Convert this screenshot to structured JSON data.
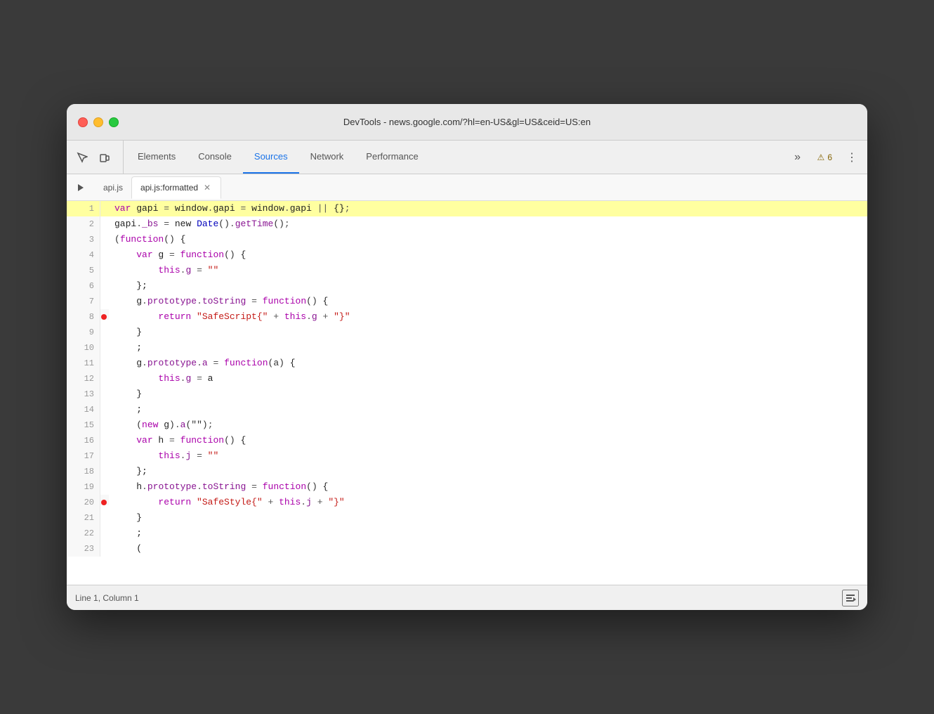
{
  "titleBar": {
    "title": "DevTools - news.google.com/?hl=en-US&gl=US&ceid=US:en"
  },
  "toolbar": {
    "tabs": [
      {
        "id": "elements",
        "label": "Elements",
        "active": false
      },
      {
        "id": "console",
        "label": "Console",
        "active": false
      },
      {
        "id": "sources",
        "label": "Sources",
        "active": true
      },
      {
        "id": "network",
        "label": "Network",
        "active": false
      },
      {
        "id": "performance",
        "label": "Performance",
        "active": false
      }
    ],
    "moreLabel": "»",
    "warningCount": "6",
    "warningIcon": "⚠"
  },
  "fileTabs": [
    {
      "id": "api-js",
      "label": "api.js",
      "active": false,
      "closeable": false
    },
    {
      "id": "api-js-formatted",
      "label": "api.js:formatted",
      "active": true,
      "closeable": true
    }
  ],
  "codeLines": [
    {
      "num": 1,
      "highlighted": true,
      "breakpoint": false,
      "tokens": [
        {
          "type": "kw",
          "text": "var"
        },
        {
          "type": "id",
          "text": " gapi "
        },
        {
          "type": "op",
          "text": "="
        },
        {
          "type": "id",
          "text": " window"
        },
        {
          "type": "op",
          "text": "."
        },
        {
          "type": "id",
          "text": "gapi "
        },
        {
          "type": "op",
          "text": "="
        },
        {
          "type": "id",
          "text": " window"
        },
        {
          "type": "op",
          "text": "."
        },
        {
          "type": "id",
          "text": "gapi "
        },
        {
          "type": "op",
          "text": "||"
        },
        {
          "type": "id",
          "text": " {}"
        },
        {
          "type": "op",
          "text": ";"
        }
      ]
    },
    {
      "num": 2,
      "highlighted": false,
      "breakpoint": false,
      "tokens": [
        {
          "type": "id",
          "text": "gapi"
        },
        {
          "type": "op",
          "text": "."
        },
        {
          "type": "prop",
          "text": "_bs"
        },
        {
          "type": "op",
          "text": " ="
        },
        {
          "type": "id",
          "text": " new "
        },
        {
          "type": "blue-id",
          "text": "Date"
        },
        {
          "type": "paren",
          "text": "()"
        },
        {
          "type": "op",
          "text": "."
        },
        {
          "type": "prop",
          "text": "getTime"
        },
        {
          "type": "paren",
          "text": "()"
        },
        {
          "type": "op",
          "text": ";"
        }
      ]
    },
    {
      "num": 3,
      "highlighted": false,
      "breakpoint": false,
      "tokens": [
        {
          "type": "paren",
          "text": "("
        },
        {
          "type": "fn-kw",
          "text": "function"
        },
        {
          "type": "paren",
          "text": "()"
        },
        {
          "type": "id",
          "text": " {"
        }
      ]
    },
    {
      "num": 4,
      "highlighted": false,
      "breakpoint": false,
      "tokens": [
        {
          "type": "id",
          "text": "    "
        },
        {
          "type": "kw",
          "text": "var"
        },
        {
          "type": "id",
          "text": " g "
        },
        {
          "type": "op",
          "text": "="
        },
        {
          "type": "id",
          "text": " "
        },
        {
          "type": "fn-kw",
          "text": "function"
        },
        {
          "type": "paren",
          "text": "()"
        },
        {
          "type": "id",
          "text": " {"
        }
      ]
    },
    {
      "num": 5,
      "highlighted": false,
      "breakpoint": false,
      "tokens": [
        {
          "type": "id",
          "text": "        "
        },
        {
          "type": "kw",
          "text": "this"
        },
        {
          "type": "op",
          "text": "."
        },
        {
          "type": "prop",
          "text": "g"
        },
        {
          "type": "op",
          "text": " ="
        },
        {
          "type": "str",
          "text": " \"\""
        }
      ]
    },
    {
      "num": 6,
      "highlighted": false,
      "breakpoint": false,
      "tokens": [
        {
          "type": "id",
          "text": "    "
        },
        {
          "type": "id",
          "text": "};"
        }
      ]
    },
    {
      "num": 7,
      "highlighted": false,
      "breakpoint": false,
      "tokens": [
        {
          "type": "id",
          "text": "    "
        },
        {
          "type": "id",
          "text": "g"
        },
        {
          "type": "op",
          "text": "."
        },
        {
          "type": "prop",
          "text": "prototype"
        },
        {
          "type": "op",
          "text": "."
        },
        {
          "type": "prop",
          "text": "toString"
        },
        {
          "type": "op",
          "text": " ="
        },
        {
          "type": "id",
          "text": " "
        },
        {
          "type": "fn-kw",
          "text": "function"
        },
        {
          "type": "paren",
          "text": "()"
        },
        {
          "type": "id",
          "text": " {"
        }
      ]
    },
    {
      "num": 8,
      "highlighted": false,
      "breakpoint": true,
      "tokens": [
        {
          "type": "id",
          "text": "        "
        },
        {
          "type": "kw",
          "text": "return"
        },
        {
          "type": "str",
          "text": " \"SafeScript{\""
        },
        {
          "type": "op",
          "text": " +"
        },
        {
          "type": "id",
          "text": " "
        },
        {
          "type": "kw",
          "text": "this"
        },
        {
          "type": "op",
          "text": "."
        },
        {
          "type": "prop",
          "text": "g"
        },
        {
          "type": "op",
          "text": " +"
        },
        {
          "type": "str",
          "text": " \"}\""
        }
      ]
    },
    {
      "num": 9,
      "highlighted": false,
      "breakpoint": false,
      "tokens": [
        {
          "type": "id",
          "text": "    }"
        }
      ]
    },
    {
      "num": 10,
      "highlighted": false,
      "breakpoint": false,
      "tokens": [
        {
          "type": "id",
          "text": "    ;"
        }
      ]
    },
    {
      "num": 11,
      "highlighted": false,
      "breakpoint": false,
      "tokens": [
        {
          "type": "id",
          "text": "    "
        },
        {
          "type": "id",
          "text": "g"
        },
        {
          "type": "op",
          "text": "."
        },
        {
          "type": "prop",
          "text": "prototype"
        },
        {
          "type": "op",
          "text": "."
        },
        {
          "type": "prop",
          "text": "a"
        },
        {
          "type": "op",
          "text": " ="
        },
        {
          "type": "id",
          "text": " "
        },
        {
          "type": "fn-kw",
          "text": "function"
        },
        {
          "type": "paren",
          "text": "(a)"
        },
        {
          "type": "id",
          "text": " {"
        }
      ]
    },
    {
      "num": 12,
      "highlighted": false,
      "breakpoint": false,
      "tokens": [
        {
          "type": "id",
          "text": "        "
        },
        {
          "type": "kw",
          "text": "this"
        },
        {
          "type": "op",
          "text": "."
        },
        {
          "type": "prop",
          "text": "g"
        },
        {
          "type": "op",
          "text": " ="
        },
        {
          "type": "id",
          "text": " a"
        }
      ]
    },
    {
      "num": 13,
      "highlighted": false,
      "breakpoint": false,
      "tokens": [
        {
          "type": "id",
          "text": "    }"
        }
      ]
    },
    {
      "num": 14,
      "highlighted": false,
      "breakpoint": false,
      "tokens": [
        {
          "type": "id",
          "text": "    ;"
        }
      ]
    },
    {
      "num": 15,
      "highlighted": false,
      "breakpoint": false,
      "tokens": [
        {
          "type": "id",
          "text": "    "
        },
        {
          "type": "paren",
          "text": "("
        },
        {
          "type": "kw",
          "text": "new"
        },
        {
          "type": "id",
          "text": " g"
        },
        {
          "type": "paren",
          "text": ")"
        },
        {
          "type": "op",
          "text": "."
        },
        {
          "type": "prop",
          "text": "a"
        },
        {
          "type": "paren",
          "text": "(\""
        },
        {
          "type": "str",
          "text": ""
        },
        {
          "type": "paren",
          "text": "\")"
        },
        {
          "type": "op",
          "text": ";"
        }
      ]
    },
    {
      "num": 16,
      "highlighted": false,
      "breakpoint": false,
      "tokens": [
        {
          "type": "id",
          "text": "    "
        },
        {
          "type": "kw",
          "text": "var"
        },
        {
          "type": "id",
          "text": " h "
        },
        {
          "type": "op",
          "text": "="
        },
        {
          "type": "id",
          "text": " "
        },
        {
          "type": "fn-kw",
          "text": "function"
        },
        {
          "type": "paren",
          "text": "()"
        },
        {
          "type": "id",
          "text": " {"
        }
      ]
    },
    {
      "num": 17,
      "highlighted": false,
      "breakpoint": false,
      "tokens": [
        {
          "type": "id",
          "text": "        "
        },
        {
          "type": "kw",
          "text": "this"
        },
        {
          "type": "op",
          "text": "."
        },
        {
          "type": "prop",
          "text": "j"
        },
        {
          "type": "op",
          "text": " ="
        },
        {
          "type": "str",
          "text": " \"\""
        }
      ]
    },
    {
      "num": 18,
      "highlighted": false,
      "breakpoint": false,
      "tokens": [
        {
          "type": "id",
          "text": "    "
        },
        {
          "type": "id",
          "text": "};"
        }
      ]
    },
    {
      "num": 19,
      "highlighted": false,
      "breakpoint": false,
      "tokens": [
        {
          "type": "id",
          "text": "    "
        },
        {
          "type": "id",
          "text": "h"
        },
        {
          "type": "op",
          "text": "."
        },
        {
          "type": "prop",
          "text": "prototype"
        },
        {
          "type": "op",
          "text": "."
        },
        {
          "type": "prop",
          "text": "toString"
        },
        {
          "type": "op",
          "text": " ="
        },
        {
          "type": "id",
          "text": " "
        },
        {
          "type": "fn-kw",
          "text": "function"
        },
        {
          "type": "paren",
          "text": "()"
        },
        {
          "type": "id",
          "text": " {"
        }
      ]
    },
    {
      "num": 20,
      "highlighted": false,
      "breakpoint": true,
      "tokens": [
        {
          "type": "id",
          "text": "        "
        },
        {
          "type": "kw",
          "text": "return"
        },
        {
          "type": "str",
          "text": " \"SafeStyle{\""
        },
        {
          "type": "op",
          "text": " +"
        },
        {
          "type": "id",
          "text": " "
        },
        {
          "type": "kw",
          "text": "this"
        },
        {
          "type": "op",
          "text": "."
        },
        {
          "type": "prop",
          "text": "j"
        },
        {
          "type": "op",
          "text": " +"
        },
        {
          "type": "str",
          "text": " \"}\""
        }
      ]
    },
    {
      "num": 21,
      "highlighted": false,
      "breakpoint": false,
      "tokens": [
        {
          "type": "id",
          "text": "    }"
        }
      ]
    },
    {
      "num": 22,
      "highlighted": false,
      "breakpoint": false,
      "tokens": [
        {
          "type": "id",
          "text": "    ;"
        }
      ]
    },
    {
      "num": 23,
      "highlighted": false,
      "breakpoint": false,
      "tokens": [
        {
          "type": "id",
          "text": "    ("
        }
      ]
    }
  ],
  "statusBar": {
    "position": "Line 1, Column 1"
  }
}
